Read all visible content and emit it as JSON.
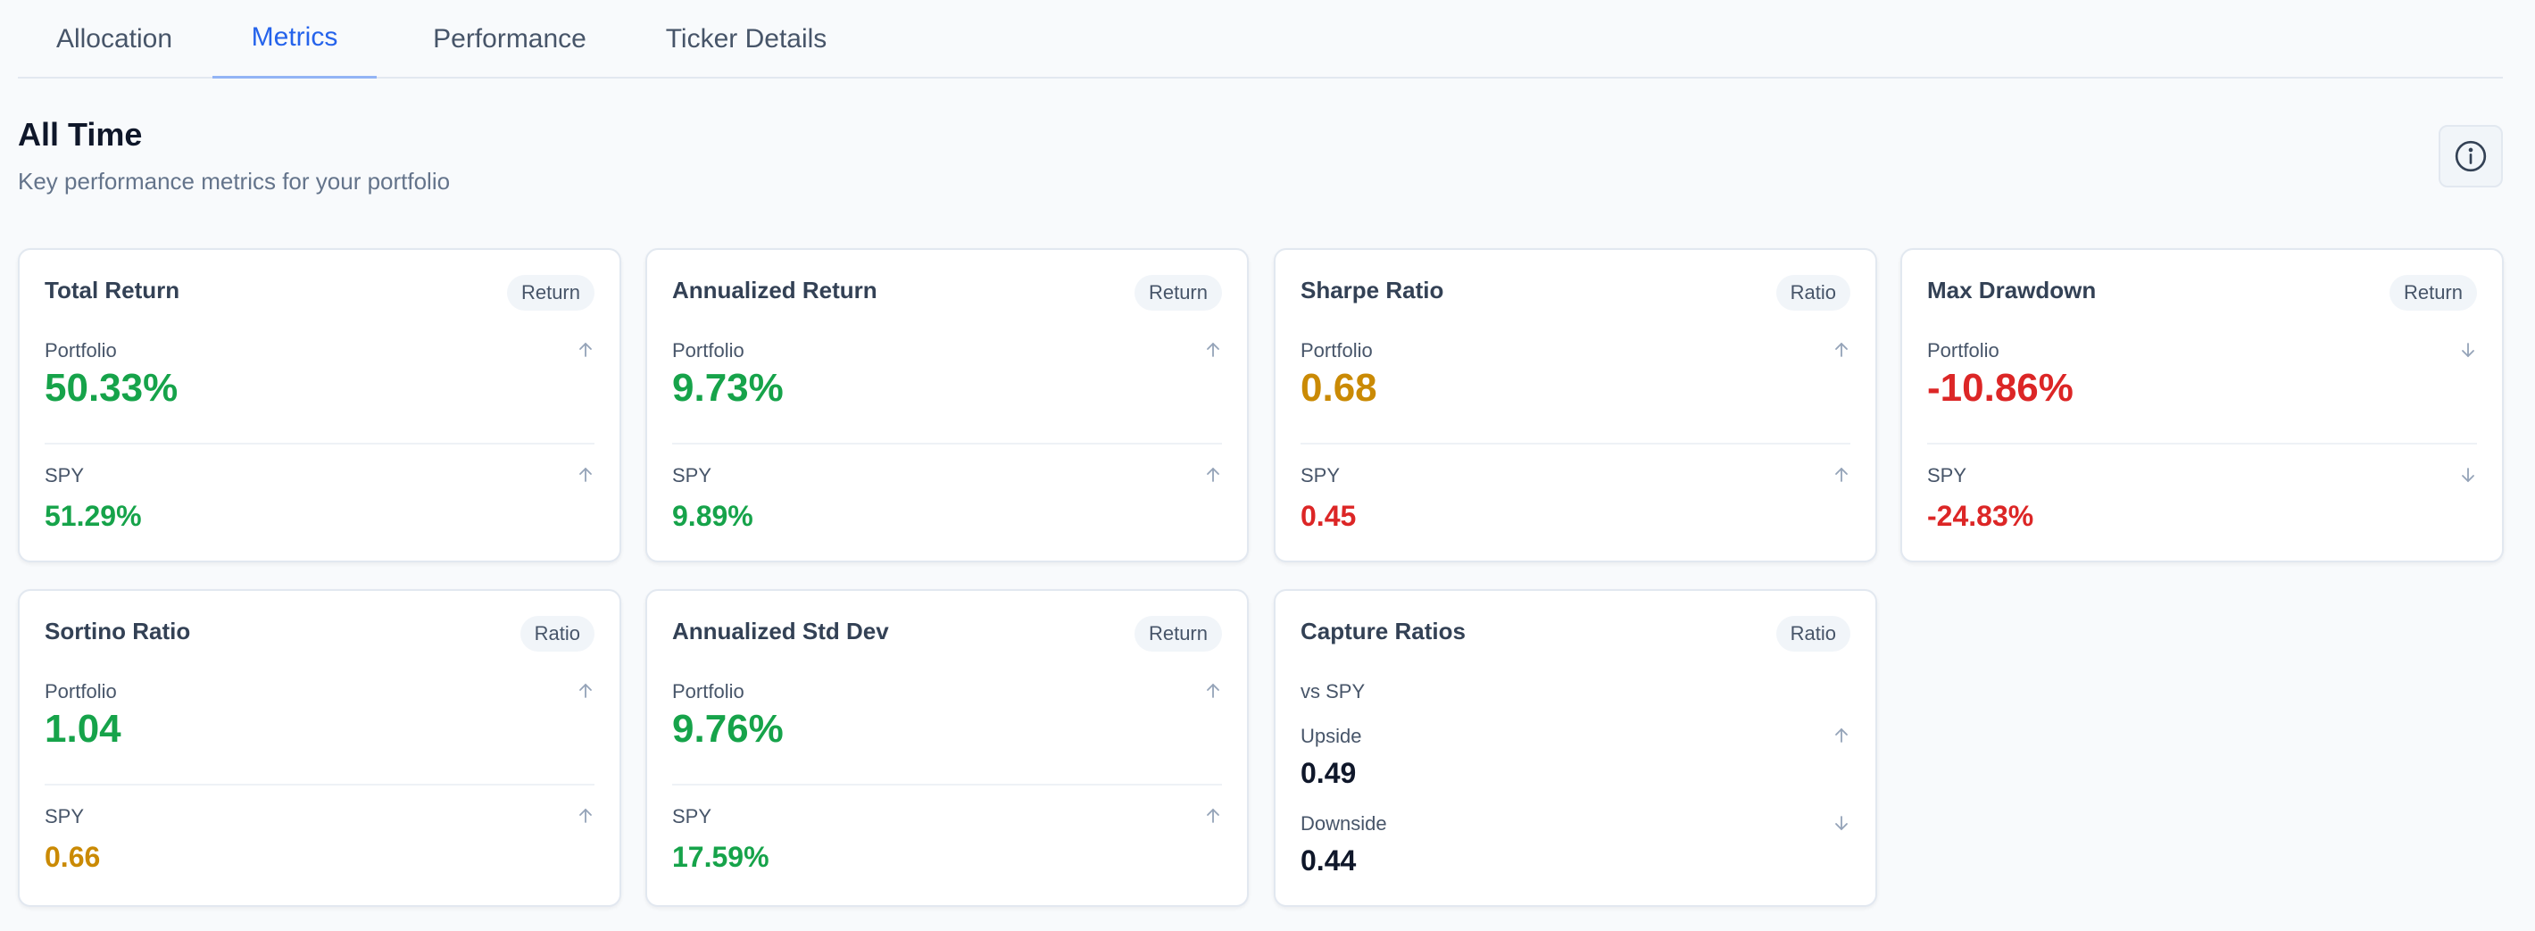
{
  "tabs": [
    "Allocation",
    "Metrics",
    "Performance",
    "Ticker Details"
  ],
  "active_tab": "Metrics",
  "section": {
    "title": "All Time",
    "subtitle": "Key performance metrics for your portfolio"
  },
  "colors": {
    "positive": "#16a34a",
    "negative": "#dc2626",
    "neutral": "#ca8a04",
    "accent": "#2563eb"
  },
  "cards": [
    {
      "title": "Total Return",
      "badge": "Return",
      "primary": {
        "label": "Portfolio",
        "value": "50.33%",
        "direction": "up",
        "tone": "positive"
      },
      "secondary": {
        "label": "SPY",
        "value": "51.29%",
        "direction": "up",
        "tone": "positive"
      }
    },
    {
      "title": "Annualized Return",
      "badge": "Return",
      "primary": {
        "label": "Portfolio",
        "value": "9.73%",
        "direction": "up",
        "tone": "positive"
      },
      "secondary": {
        "label": "SPY",
        "value": "9.89%",
        "direction": "up",
        "tone": "positive"
      }
    },
    {
      "title": "Sharpe Ratio",
      "badge": "Ratio",
      "primary": {
        "label": "Portfolio",
        "value": "0.68",
        "direction": "up",
        "tone": "neutral"
      },
      "secondary": {
        "label": "SPY",
        "value": "0.45",
        "direction": "up",
        "tone": "negative"
      }
    },
    {
      "title": "Max Drawdown",
      "badge": "Return",
      "primary": {
        "label": "Portfolio",
        "value": "-10.86%",
        "direction": "down",
        "tone": "negative"
      },
      "secondary": {
        "label": "SPY",
        "value": "-24.83%",
        "direction": "down",
        "tone": "negative"
      }
    },
    {
      "title": "Sortino Ratio",
      "badge": "Ratio",
      "primary": {
        "label": "Portfolio",
        "value": "1.04",
        "direction": "up",
        "tone": "positive"
      },
      "secondary": {
        "label": "SPY",
        "value": "0.66",
        "direction": "up",
        "tone": "neutral"
      }
    },
    {
      "title": "Annualized Std Dev",
      "badge": "Return",
      "primary": {
        "label": "Portfolio",
        "value": "9.76%",
        "direction": "up",
        "tone": "positive"
      },
      "secondary": {
        "label": "SPY",
        "value": "17.59%",
        "direction": "up",
        "tone": "positive"
      }
    }
  ],
  "capture": {
    "title": "Capture Ratios",
    "badge": "Ratio",
    "benchmark": "vs SPY",
    "upside": {
      "label": "Upside",
      "value": "0.49",
      "direction": "up"
    },
    "downside": {
      "label": "Downside",
      "value": "0.44",
      "direction": "down"
    }
  },
  "icons": {
    "info": "info-circle-icon",
    "up": "arrow-up-icon",
    "down": "arrow-down-icon"
  }
}
